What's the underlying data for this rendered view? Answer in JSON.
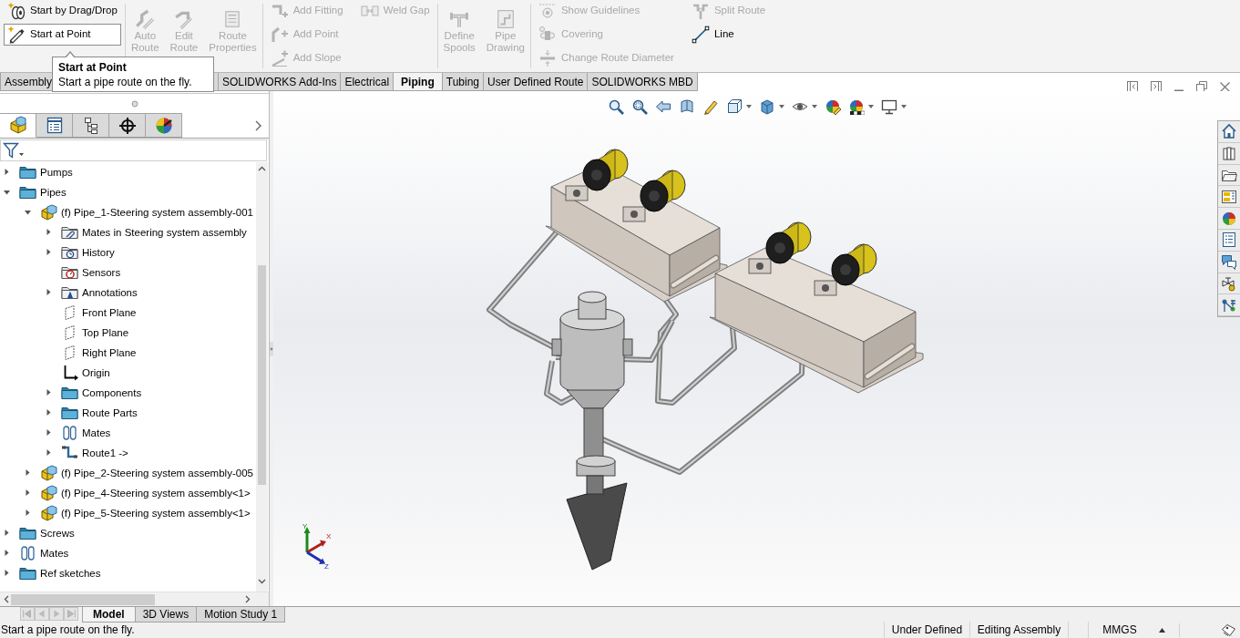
{
  "ribbon": {
    "groups": [
      {
        "kind": "small",
        "columns": [
          [
            {
              "label": "Start by Drag/Drop",
              "disabled": false,
              "highlighted": false
            },
            {
              "label": "Start at Point",
              "disabled": false,
              "highlighted": true
            }
          ]
        ]
      },
      {
        "kind": "large",
        "commands": [
          {
            "label": "Auto Route",
            "disabled": true
          },
          {
            "label": "Edit Route",
            "disabled": true
          },
          {
            "label": "Route Properties",
            "disabled": true
          }
        ]
      },
      {
        "kind": "small",
        "columns": [
          [
            {
              "label": "Add Fitting",
              "disabled": true,
              "highlighted": false
            },
            {
              "label": "Add Point",
              "disabled": true,
              "highlighted": false
            },
            {
              "label": "Add Slope",
              "disabled": true,
              "highlighted": false
            }
          ],
          [
            {
              "label": "Weld Gap",
              "disabled": true,
              "highlighted": false
            }
          ]
        ]
      },
      {
        "kind": "large",
        "commands": [
          {
            "label": "Define Spools",
            "disabled": true
          },
          {
            "label": "Pipe Drawing",
            "disabled": true
          }
        ]
      },
      {
        "kind": "small",
        "columns": [
          [
            {
              "label": "Show Guidelines",
              "disabled": true,
              "highlighted": false
            },
            {
              "label": "Covering",
              "disabled": true,
              "highlighted": false
            },
            {
              "label": "Change Route Diameter",
              "disabled": true,
              "highlighted": false
            }
          ],
          [
            {
              "label": "Split Route",
              "disabled": true,
              "highlighted": false
            },
            {
              "label": "Line",
              "disabled": false,
              "highlighted": false
            }
          ]
        ]
      }
    ]
  },
  "tooltip": {
    "title": "Start at Point",
    "text": "Start a pipe route on the fly."
  },
  "command_tabs": [
    {
      "label": "Assembly",
      "selected": false
    },
    {
      "label": "SOLIDWORKS Add-Ins",
      "selected": false
    },
    {
      "label": "Electrical",
      "selected": false
    },
    {
      "label": "Piping",
      "selected": true
    },
    {
      "label": "Tubing",
      "selected": false
    },
    {
      "label": "User Defined Route",
      "selected": false
    },
    {
      "label": "SOLIDWORKS MBD",
      "selected": false
    }
  ],
  "panel_tabs": [
    {
      "selected": true
    },
    {
      "selected": false
    },
    {
      "selected": false
    },
    {
      "selected": false
    },
    {
      "selected": false
    }
  ],
  "feature_tree": [
    {
      "label": "Pumps",
      "kind": "folder",
      "expanded": false
    },
    {
      "label": "Pipes",
      "kind": "folder",
      "expanded": true,
      "children": [
        {
          "label": "(f) Pipe_1-Steering system assembly-001",
          "kind": "assembly",
          "expanded": true,
          "children": [
            {
              "label": "Mates in Steering system assembly",
              "kind": "matefolder",
              "expanded": false
            },
            {
              "label": "History",
              "kind": "history",
              "expanded": false
            },
            {
              "label": "Sensors",
              "kind": "sensors"
            },
            {
              "label": "Annotations",
              "kind": "annotations",
              "expanded": false
            },
            {
              "label": "Front Plane",
              "kind": "plane"
            },
            {
              "label": "Top Plane",
              "kind": "plane"
            },
            {
              "label": "Right Plane",
              "kind": "plane"
            },
            {
              "label": "Origin",
              "kind": "origin"
            },
            {
              "label": "Components",
              "kind": "folder",
              "expanded": false
            },
            {
              "label": "Route Parts",
              "kind": "folder",
              "expanded": false
            },
            {
              "label": "Mates",
              "kind": "mates",
              "expanded": false
            },
            {
              "label": "Route1 ->",
              "kind": "route",
              "expanded": false
            }
          ]
        },
        {
          "label": "(f) Pipe_2-Steering system assembly-005",
          "kind": "assembly",
          "expanded": false
        },
        {
          "label": "(f) Pipe_4-Steering system assembly<1>",
          "kind": "assembly",
          "expanded": false
        },
        {
          "label": "(f) Pipe_5-Steering system assembly<1>",
          "kind": "assembly",
          "expanded": false
        }
      ]
    },
    {
      "label": "Screws",
      "kind": "folder",
      "expanded": false
    },
    {
      "label": "Mates",
      "kind": "mates",
      "expanded": false
    },
    {
      "label": "Ref sketches",
      "kind": "folder",
      "expanded": false
    }
  ],
  "triad": {
    "labels": [
      "X",
      "Y",
      "Z"
    ]
  },
  "model_tabs": [
    {
      "label": "Model",
      "selected": true
    },
    {
      "label": "3D Views",
      "selected": false
    },
    {
      "label": "Motion Study 1",
      "selected": false
    }
  ],
  "status_bar": {
    "message": "Start a pipe route on the fly.",
    "fields": [
      "Under Defined",
      "Editing Assembly",
      "MMGS"
    ]
  }
}
